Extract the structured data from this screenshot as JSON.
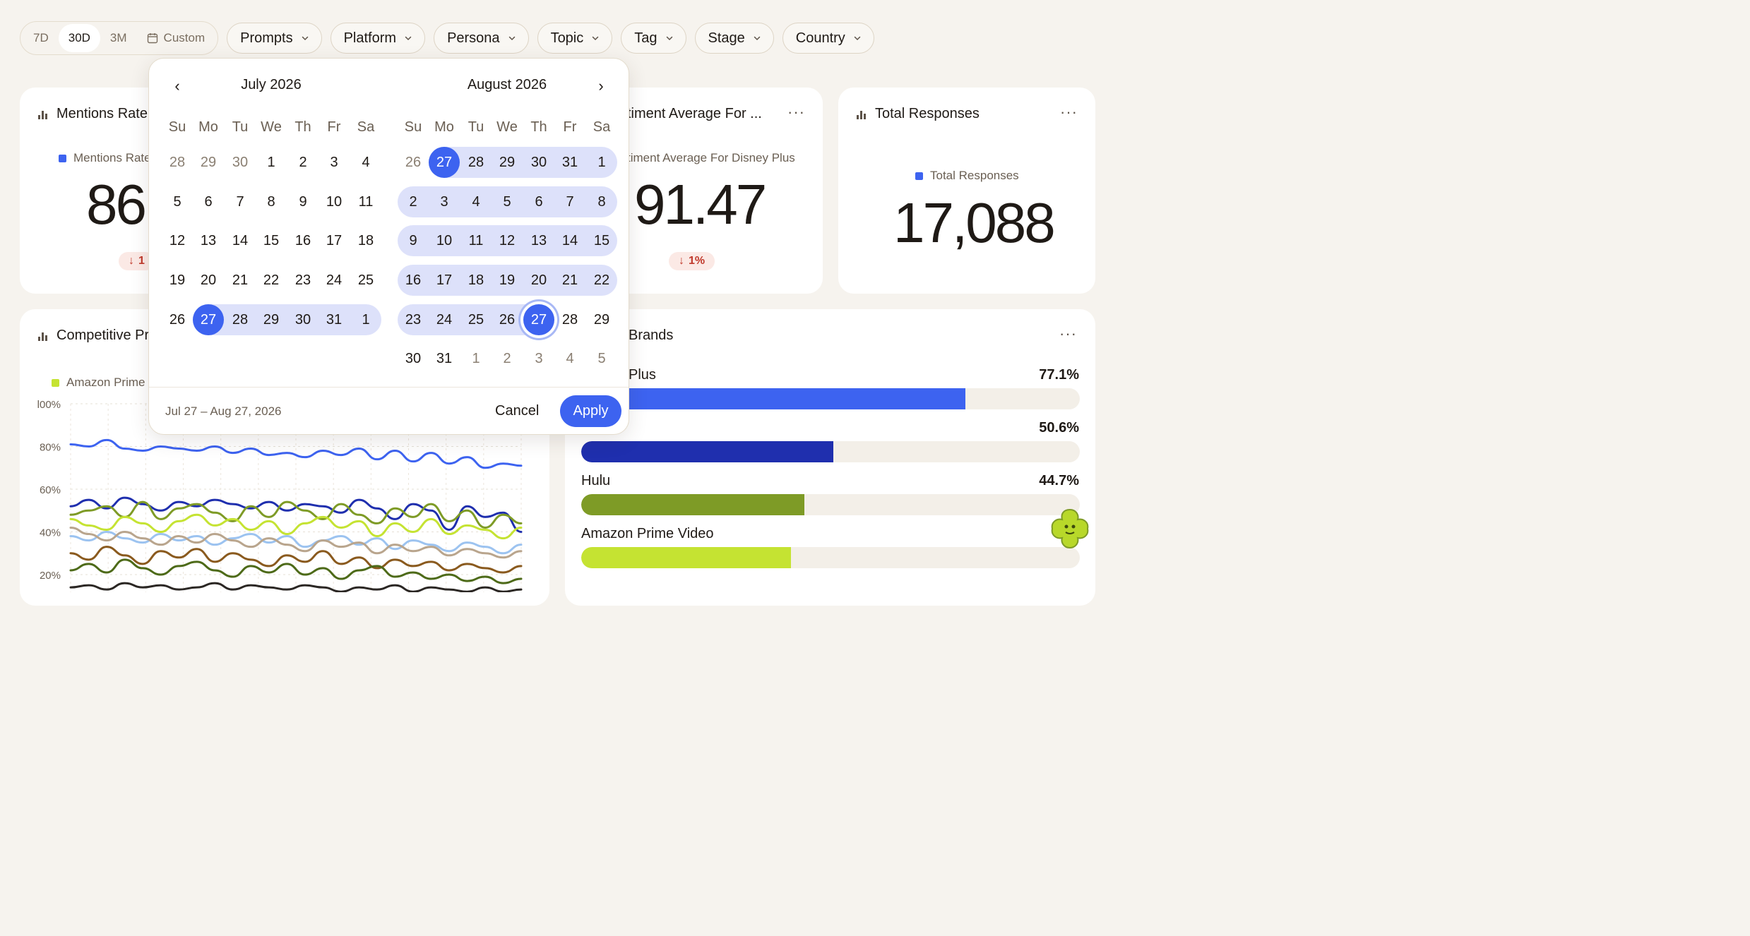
{
  "filters": {
    "range_options": [
      "7D",
      "30D",
      "3M"
    ],
    "custom_label": "Custom",
    "active_range": "30D",
    "dropdowns": [
      "Prompts",
      "Platform",
      "Persona",
      "Topic",
      "Tag",
      "Stage",
      "Country"
    ]
  },
  "cards": {
    "mentions": {
      "title": "Mentions Rate",
      "legend": "Mentions Rate",
      "value": "86",
      "delta": "1"
    },
    "sentiment": {
      "title": "timent Average For ...",
      "legend": "timent Average For Disney Plus",
      "value": "91.47",
      "delta": "1%"
    },
    "total": {
      "title": "Total Responses",
      "legend": "Total Responses",
      "value": "17,088"
    },
    "competitive": {
      "title": "Competitive Pr",
      "legend": "Amazon Prime"
    },
    "brands": {
      "title": "Brands",
      "items": [
        {
          "label": "Plus",
          "pct": "77.1%",
          "value": 77.1,
          "color": "#3d63f0"
        },
        {
          "label": "",
          "pct": "50.6%",
          "value": 50.6,
          "color": "#1f2fae"
        },
        {
          "label": "Hulu",
          "pct": "44.7%",
          "value": 44.7,
          "color": "#7e9b26"
        },
        {
          "label": "Amazon Prime Video",
          "pct": "",
          "value": 42.0,
          "color": "#c5e332"
        }
      ]
    }
  },
  "calendar": {
    "left_month": "July 2026",
    "right_month": "August 2026",
    "weekdays": [
      "Su",
      "Mo",
      "Tu",
      "We",
      "Th",
      "Fr",
      "Sa"
    ],
    "left_weeks": [
      [
        "28",
        "29",
        "30",
        "1",
        "2",
        "3",
        "4"
      ],
      [
        "5",
        "6",
        "7",
        "8",
        "9",
        "10",
        "11"
      ],
      [
        "12",
        "13",
        "14",
        "15",
        "16",
        "17",
        "18"
      ],
      [
        "19",
        "20",
        "21",
        "22",
        "23",
        "24",
        "25"
      ],
      [
        "26",
        "27",
        "28",
        "29",
        "30",
        "31",
        "1"
      ]
    ],
    "right_weeks": [
      [
        "26",
        "27",
        "28",
        "29",
        "30",
        "31",
        "1"
      ],
      [
        "2",
        "3",
        "4",
        "5",
        "6",
        "7",
        "8"
      ],
      [
        "9",
        "10",
        "11",
        "12",
        "13",
        "14",
        "15"
      ],
      [
        "16",
        "17",
        "18",
        "19",
        "20",
        "21",
        "22"
      ],
      [
        "23",
        "24",
        "25",
        "26",
        "27",
        "28",
        "29"
      ],
      [
        "30",
        "31",
        "1",
        "2",
        "3",
        "4",
        "5"
      ]
    ],
    "range_text": "Jul 27 – Aug 27, 2026",
    "cancel_label": "Cancel",
    "apply_label": "Apply"
  },
  "chart_data": {
    "type": "line",
    "yticks": [
      "20%",
      "40%",
      "60%",
      "80%",
      "l00%"
    ],
    "ylim": [
      20,
      100
    ],
    "series": [
      {
        "color": "#3d63f0",
        "values": [
          81,
          80,
          83,
          79,
          78,
          80,
          79,
          78,
          80,
          77,
          79,
          76,
          77,
          75,
          78,
          76,
          79,
          74,
          78,
          73,
          77,
          72,
          75,
          70,
          72,
          71
        ]
      },
      {
        "color": "#1f2fae",
        "values": [
          52,
          55,
          51,
          56,
          53,
          50,
          54,
          52,
          55,
          53,
          51,
          54,
          50,
          53,
          52,
          49,
          55,
          51,
          46,
          53,
          50,
          41,
          52,
          47,
          49,
          40
        ]
      },
      {
        "color": "#7e9b26",
        "values": [
          48,
          50,
          52,
          47,
          54,
          46,
          51,
          53,
          49,
          45,
          52,
          47,
          54,
          50,
          46,
          53,
          48,
          44,
          51,
          47,
          53,
          45,
          50,
          42,
          48,
          44
        ]
      },
      {
        "color": "#c5e332",
        "values": [
          46,
          43,
          41,
          47,
          44,
          40,
          45,
          48,
          43,
          46,
          41,
          45,
          39,
          44,
          47,
          42,
          45,
          38,
          44,
          40,
          46,
          39,
          43,
          41,
          37,
          42
        ]
      },
      {
        "color": "#9cc3f0",
        "values": [
          38,
          36,
          40,
          37,
          35,
          39,
          36,
          38,
          34,
          37,
          39,
          35,
          38,
          33,
          36,
          38,
          34,
          37,
          32,
          36,
          34,
          31,
          35,
          33,
          30,
          34
        ]
      },
      {
        "color": "#b9a58d",
        "values": [
          42,
          39,
          36,
          40,
          37,
          34,
          38,
          35,
          39,
          36,
          33,
          37,
          34,
          31,
          36,
          33,
          35,
          30,
          34,
          31,
          33,
          29,
          32,
          30,
          28,
          31
        ]
      },
      {
        "color": "#8a5a1e",
        "values": [
          30,
          27,
          33,
          29,
          25,
          31,
          28,
          32,
          26,
          30,
          27,
          24,
          29,
          26,
          31,
          25,
          28,
          23,
          27,
          24,
          26,
          22,
          25,
          23,
          21,
          24
        ]
      },
      {
        "color": "#4d6a18",
        "values": [
          22,
          25,
          21,
          27,
          23,
          20,
          24,
          26,
          22,
          19,
          24,
          21,
          25,
          20,
          23,
          18,
          22,
          24,
          19,
          21,
          18,
          20,
          17,
          19,
          16,
          18
        ]
      },
      {
        "color": "#2b2724",
        "values": [
          14,
          15,
          13,
          16,
          14,
          15,
          13,
          14,
          16,
          13,
          15,
          14,
          13,
          15,
          14,
          12,
          14,
          13,
          15,
          12,
          14,
          13,
          12,
          14,
          12,
          13
        ]
      }
    ]
  }
}
